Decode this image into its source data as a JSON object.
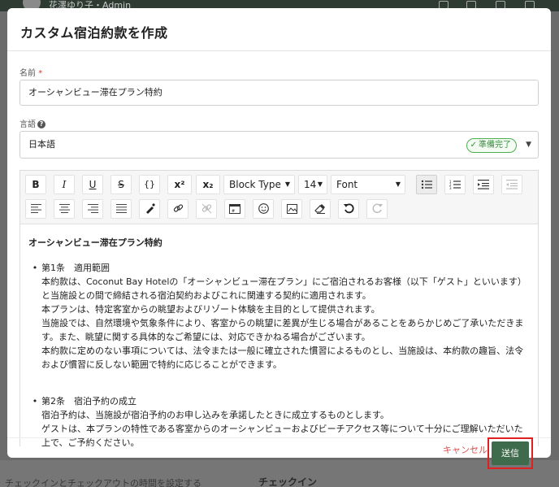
{
  "background": {
    "user_name": "花澤ゆり子・Admin",
    "bottom_left_text": "チェックインとチェックアウトの時間を設定する",
    "bottom_mid_text": "チェックイン"
  },
  "modal": {
    "title": "カスタム宿泊約款を作成",
    "name_field": {
      "label": "名前",
      "required_mark": "*",
      "value": "オーシャンビュー滞在プラン特約"
    },
    "language_field": {
      "label": "言語",
      "help_icon": "?",
      "value": "日本語",
      "status_badge": "準備完了",
      "badge_icon": "check-icon",
      "caret": "▼"
    },
    "toolbar": {
      "bold": "B",
      "italic": "I",
      "underline": "U",
      "strikethrough": "S",
      "code_block": "{}",
      "superscript": "x²",
      "subscript": "x₂",
      "block_type": "Block Type",
      "font_size": "14",
      "font": "Font"
    },
    "content": {
      "title": "オーシャンビュー滞在プラン特約",
      "articles": [
        {
          "heading": "第1条　適用範囲",
          "body": "本約款は、Coconut Bay Hotelの「オーシャンビュー滞在プラン」にご宿泊されるお客様（以下「ゲスト」といいます）と当施設との間で締結される宿泊契約およびこれに関連する契約に適用されます。\n本プランは、特定客室からの眺望およびリゾート体験を主目的として提供されます。\n当施設では、自然環境や気象条件により、客室からの眺望に差異が生じる場合があることをあらかじめご了承いただきます。また、眺望に関する具体的なご希望には、対応できかねる場合がございます。\n本約款に定めのない事項については、法令または一般に確立された慣習によるものとし、当施設は、本約款の趣旨、法令および慣習に反しない範囲で特約に応じることができます。"
        },
        {
          "heading": "第2条　宿泊予約の成立",
          "body": "宿泊予約は、当施設が宿泊予約のお申し込みを承諾したときに成立するものとします。\nゲストは、本プランの特性である客室からのオーシャンビューおよびビーチアクセス等について十分にご理解いただいた上で、ご予約ください。"
        }
      ]
    },
    "footer": {
      "cancel": "キャンセル",
      "submit": "送信"
    }
  }
}
